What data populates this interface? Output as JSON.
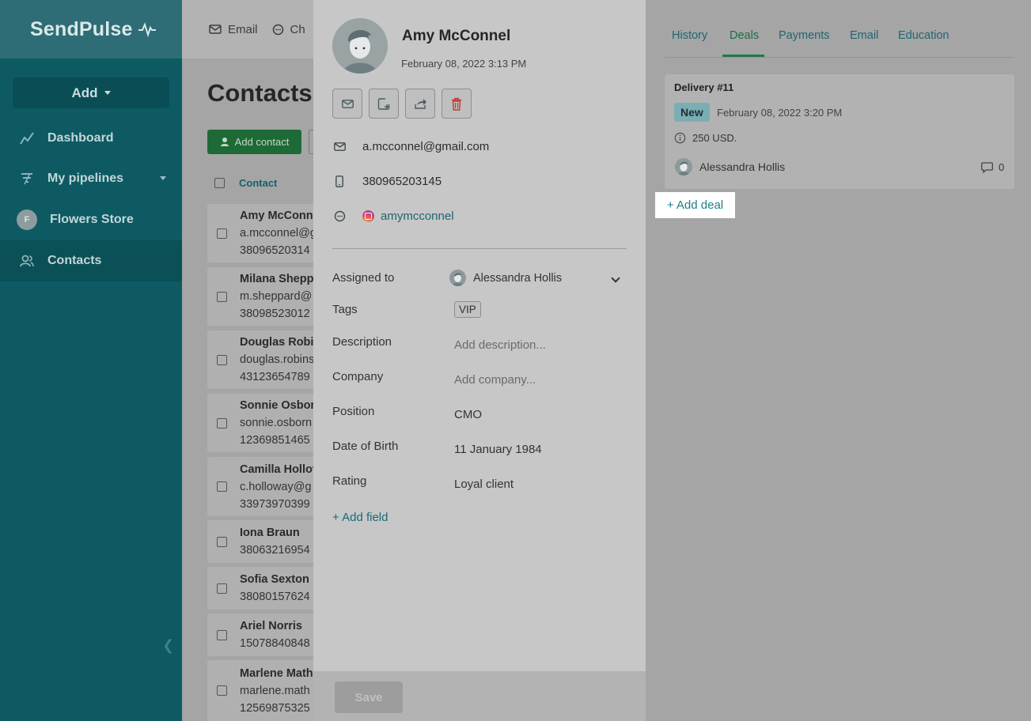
{
  "sidebar": {
    "logo": "SendPulse",
    "add_label": "Add",
    "items": [
      {
        "label": "Dashboard"
      },
      {
        "label": "My pipelines"
      },
      {
        "label": "Flowers Store",
        "avatar": "F"
      },
      {
        "label": "Contacts"
      }
    ]
  },
  "topbar": {
    "email_label": "Email",
    "chat_label": "Ch"
  },
  "contacts_page": {
    "title": "Contacts",
    "add_contact_label": "Add contact",
    "column_contact": "Contact",
    "rows": [
      {
        "name": "Amy McConn",
        "email": "a.mcconnel@g",
        "phone": "38096520314"
      },
      {
        "name": "Milana Shepp",
        "email": "m.sheppard@",
        "phone": "38098523012"
      },
      {
        "name": "Douglas Robi",
        "email": "douglas.robins",
        "phone": "43123654789"
      },
      {
        "name": "Sonnie Osbor",
        "email": "sonnie.osborn",
        "phone": "12369851465"
      },
      {
        "name": "Camilla Hollov",
        "email": "c.holloway@g",
        "phone": "33973970399"
      },
      {
        "name": "Iona Braun",
        "phone": "38063216954"
      },
      {
        "name": "Sofia Sexton",
        "phone": "38080157624"
      },
      {
        "name": "Ariel Norris",
        "phone": "15078840848"
      },
      {
        "name": "Marlene Math",
        "email": "marlene.math",
        "phone": "12569875325"
      }
    ]
  },
  "contact": {
    "name": "Amy McConnel",
    "created": "February 08, 2022 3:13 PM",
    "email": "a.mcconnel@gmail.com",
    "phone": "380965203145",
    "instagram": "amymcconnel",
    "fields": {
      "assigned_label": "Assigned to",
      "assigned_value": "Alessandra Hollis",
      "tags_label": "Tags",
      "tag_value": "VIP",
      "description_label": "Description",
      "description_placeholder": "Add description...",
      "company_label": "Company",
      "company_placeholder": "Add company...",
      "position_label": "Position",
      "position_value": "CMO",
      "dob_label": "Date of Birth",
      "dob_value": "11 January 1984",
      "rating_label": "Rating",
      "rating_value": "Loyal client"
    },
    "add_field_label": "+ Add field",
    "save_label": "Save"
  },
  "tabs": [
    {
      "label": "History"
    },
    {
      "label": "Deals",
      "active": true
    },
    {
      "label": "Payments"
    },
    {
      "label": "Email"
    },
    {
      "label": "Education"
    }
  ],
  "deal": {
    "title": "Delivery #11",
    "status": "New",
    "date": "February 08, 2022 3:20 PM",
    "amount": "250 USD.",
    "owner": "Alessandra Hollis",
    "comments": "0"
  },
  "add_deal_label": "+ Add deal",
  "colors": {
    "sidebar": "#0d5a63",
    "accent_green": "#1f7a44",
    "link": "#1a7f8a"
  }
}
